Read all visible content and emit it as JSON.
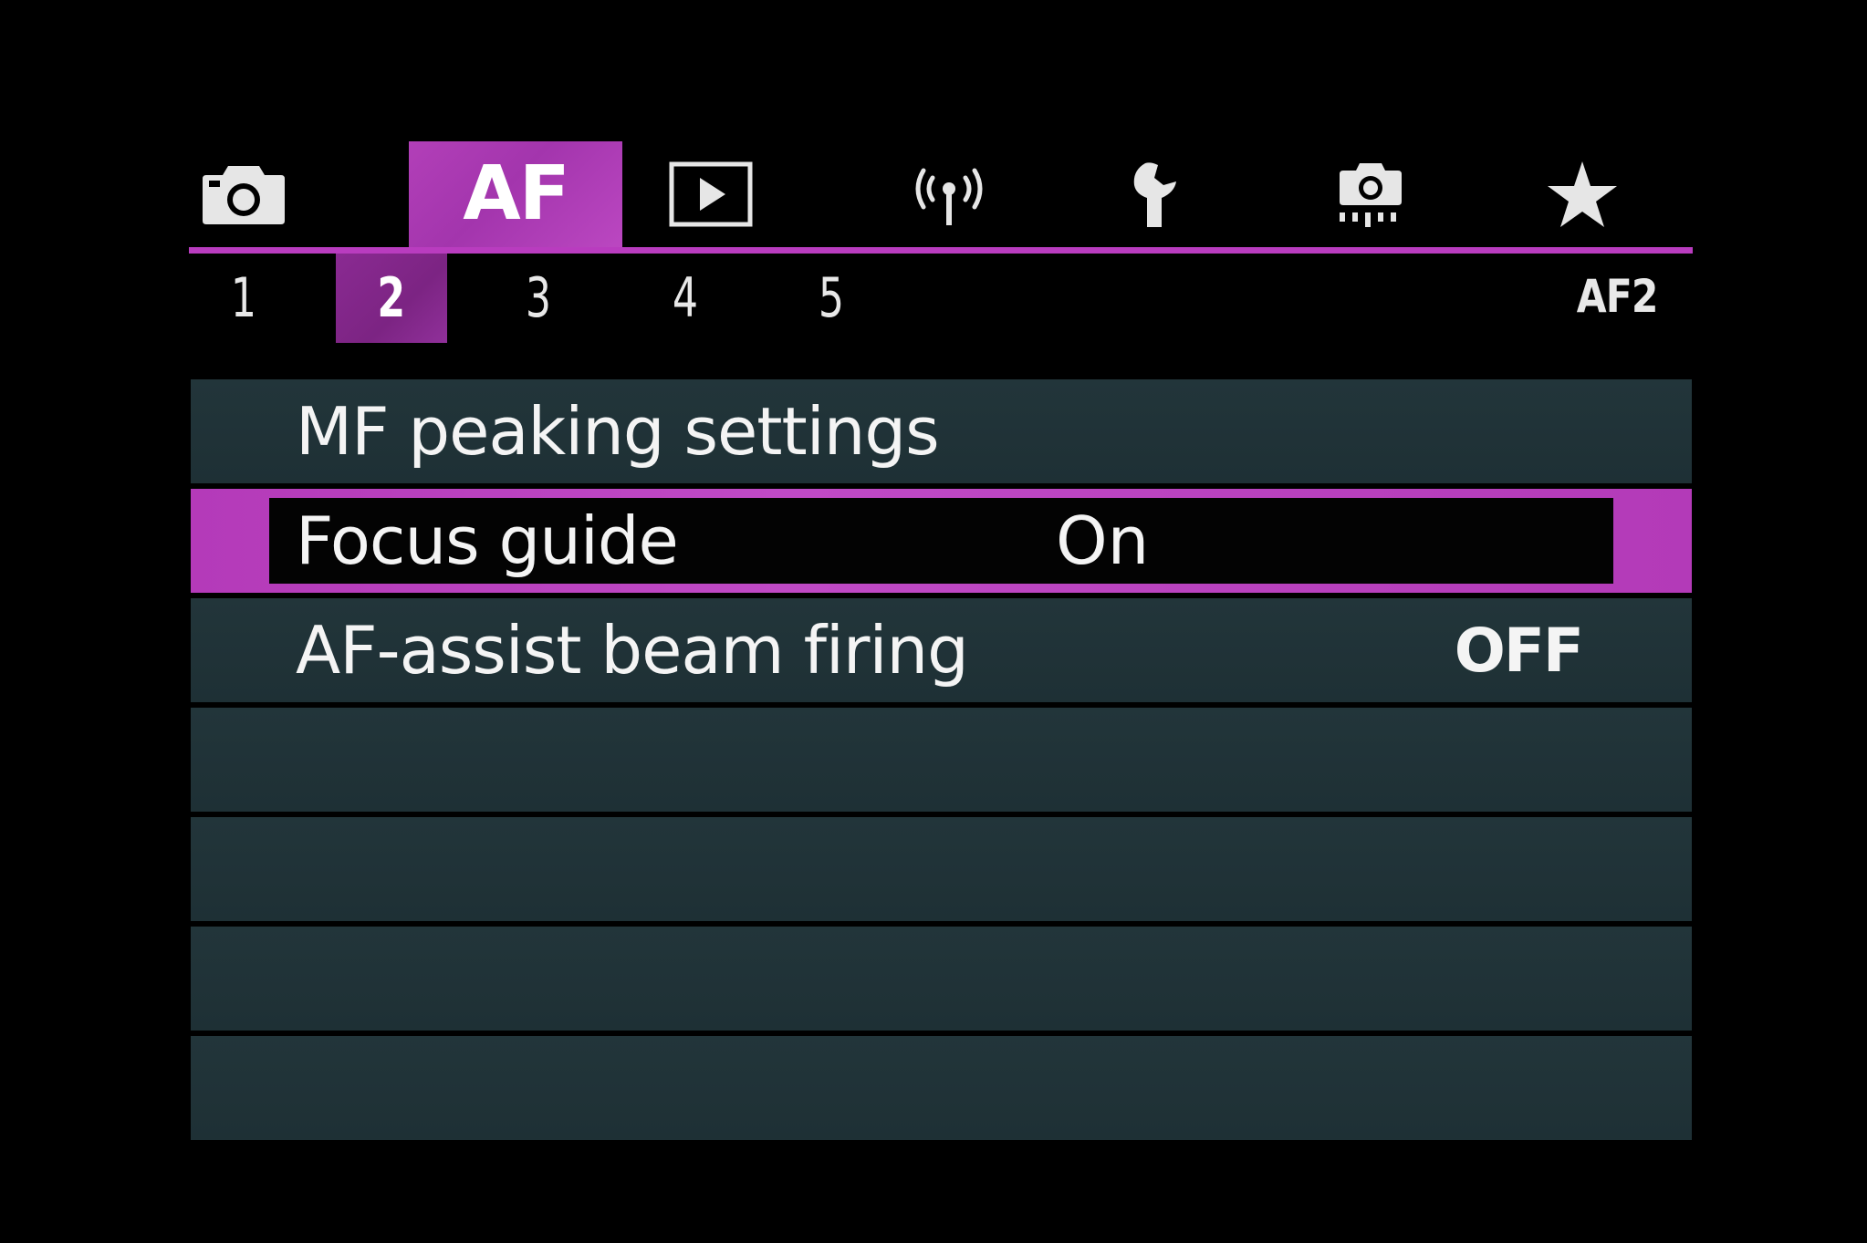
{
  "tabs": [
    {
      "icon": "camera-icon",
      "label": "",
      "active": false
    },
    {
      "icon": "af-icon",
      "label": "AF",
      "active": true
    },
    {
      "icon": "playback-icon",
      "label": "",
      "active": false
    },
    {
      "icon": "wireless-icon",
      "label": "",
      "active": false
    },
    {
      "icon": "wrench-icon",
      "label": "",
      "active": false
    },
    {
      "icon": "custom-functions-icon",
      "label": "",
      "active": false
    },
    {
      "icon": "star-icon",
      "label": "",
      "active": false
    }
  ],
  "subtabs": [
    "1",
    "2",
    "3",
    "4",
    "5"
  ],
  "active_subtab": "2",
  "page_indicator": "AF2",
  "menu": {
    "items": [
      {
        "label": "MF peaking settings",
        "value": ""
      },
      {
        "label": "Focus guide",
        "value": "On",
        "selected": true
      },
      {
        "label": "AF-assist beam firing",
        "value": "OFF"
      },
      {
        "label": "",
        "value": ""
      },
      {
        "label": "",
        "value": ""
      },
      {
        "label": "",
        "value": ""
      },
      {
        "label": "",
        "value": ""
      }
    ]
  },
  "colors": {
    "accent": "#b93cbf",
    "row_background": "#21333a",
    "selected_inner": "#030303",
    "background": "#000000"
  }
}
